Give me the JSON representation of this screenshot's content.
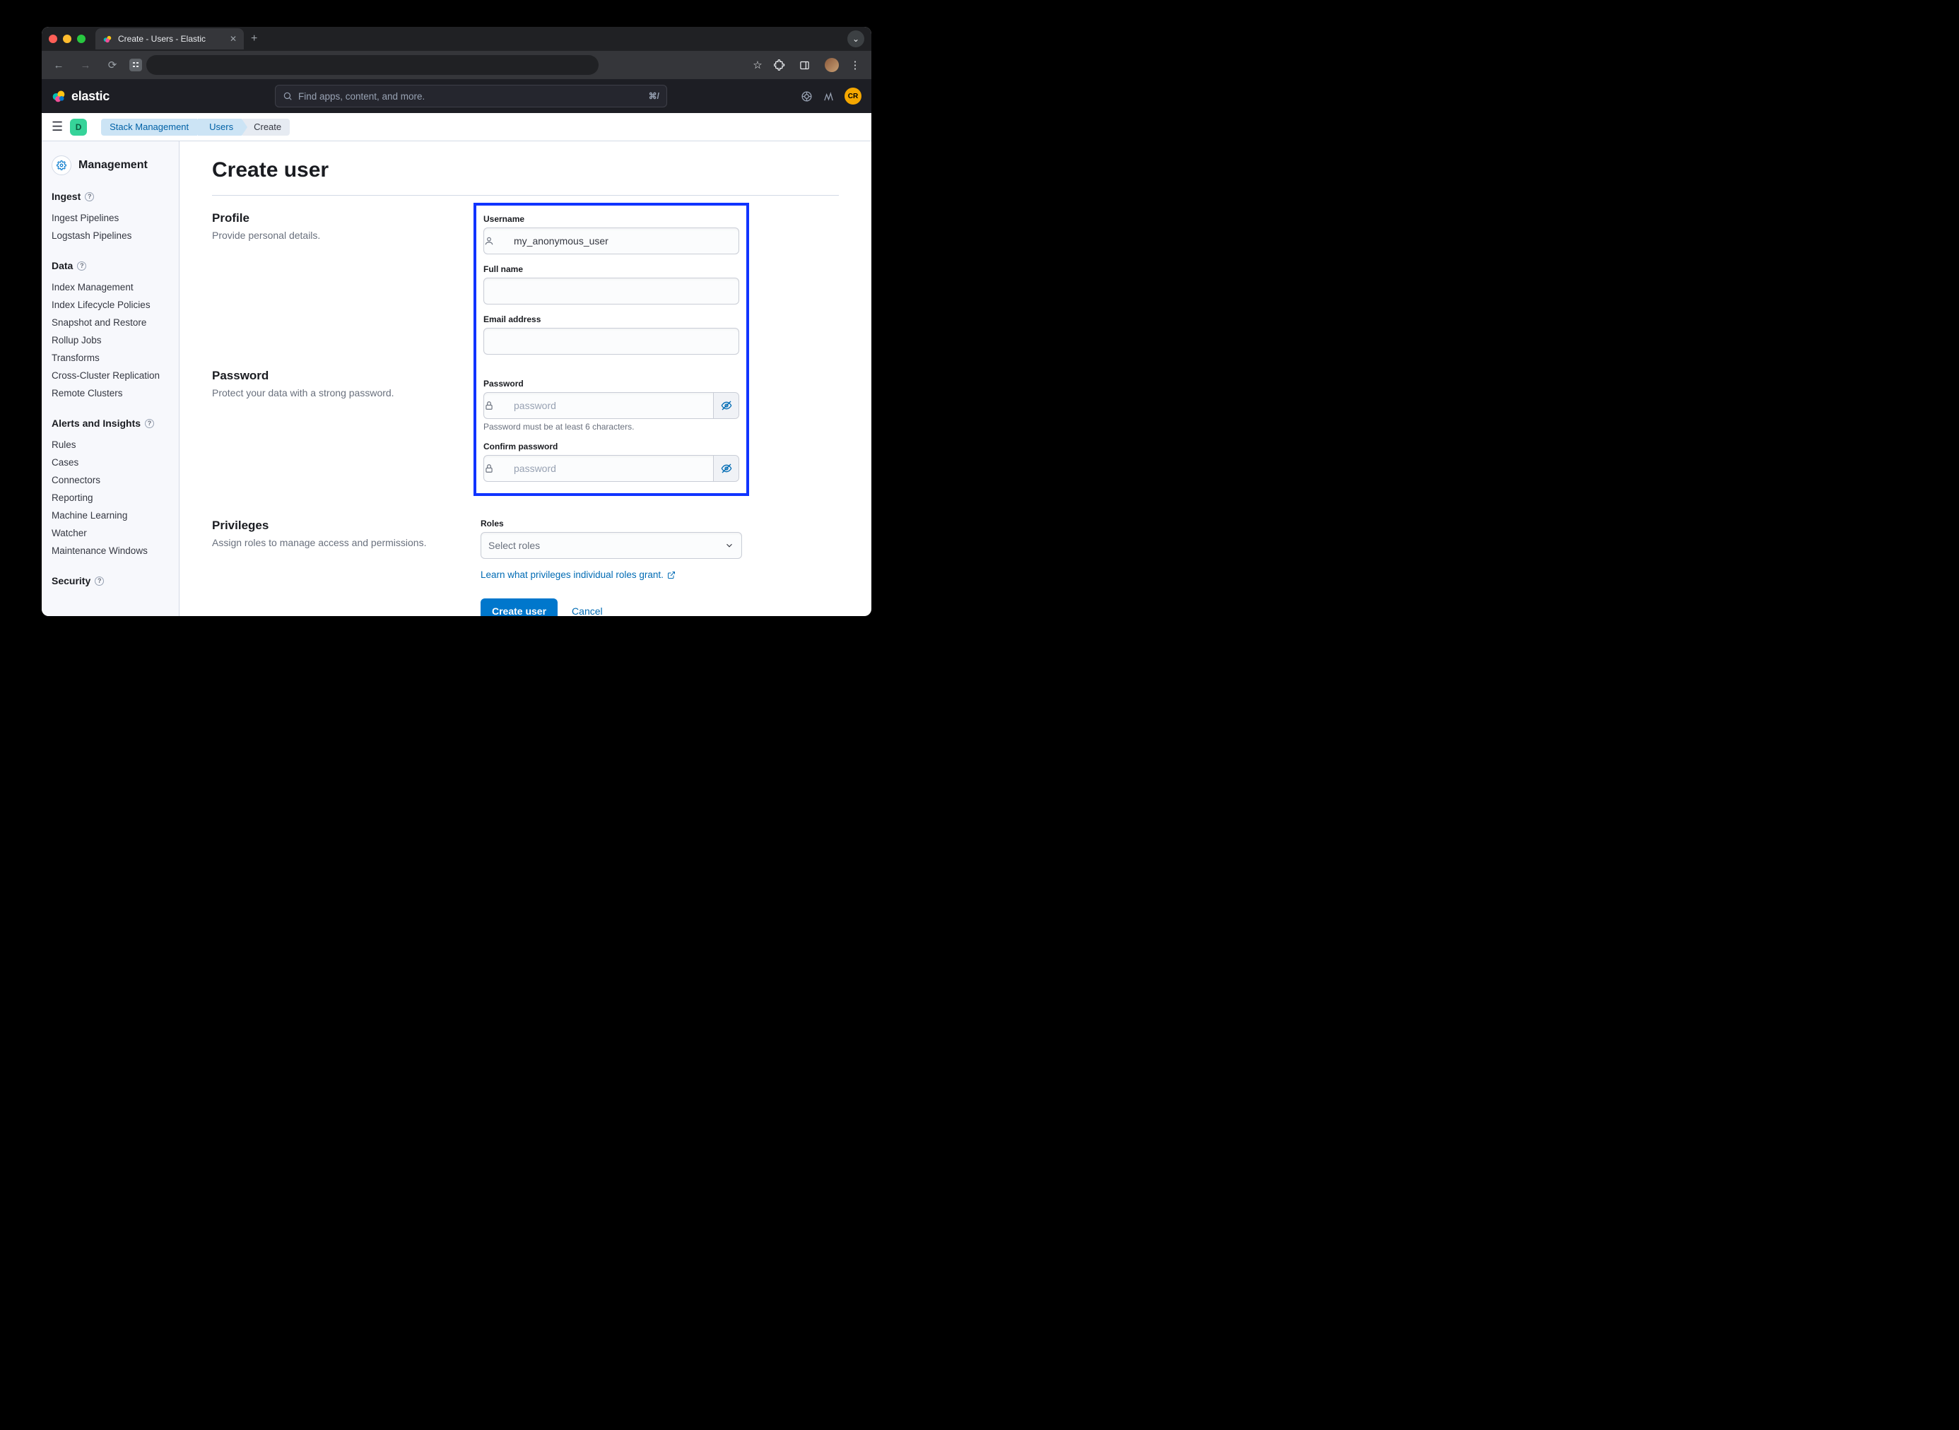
{
  "browser": {
    "tab_title": "Create - Users - Elastic"
  },
  "header": {
    "brand": "elastic",
    "search_placeholder": "Find apps, content, and more.",
    "search_shortcut": "⌘/",
    "avatar_initials": "CR"
  },
  "breadcrumb": {
    "space_initial": "D",
    "items": [
      "Stack Management",
      "Users",
      "Create"
    ]
  },
  "sidebar": {
    "title": "Management",
    "groups": [
      {
        "title": "Ingest",
        "help": true,
        "items": [
          "Ingest Pipelines",
          "Logstash Pipelines"
        ]
      },
      {
        "title": "Data",
        "help": true,
        "items": [
          "Index Management",
          "Index Lifecycle Policies",
          "Snapshot and Restore",
          "Rollup Jobs",
          "Transforms",
          "Cross-Cluster Replication",
          "Remote Clusters"
        ]
      },
      {
        "title": "Alerts and Insights",
        "help": true,
        "items": [
          "Rules",
          "Cases",
          "Connectors",
          "Reporting",
          "Machine Learning",
          "Watcher",
          "Maintenance Windows"
        ]
      },
      {
        "title": "Security",
        "help": true,
        "items": []
      }
    ]
  },
  "page": {
    "title": "Create user",
    "sections": {
      "profile": {
        "heading": "Profile",
        "desc": "Provide personal details.",
        "username_label": "Username",
        "username_value": "my_anonymous_user",
        "fullname_label": "Full name",
        "fullname_value": "",
        "email_label": "Email address",
        "email_value": ""
      },
      "password": {
        "heading": "Password",
        "desc": "Protect your data with a strong password.",
        "password_label": "Password",
        "password_placeholder": "password",
        "password_hint": "Password must be at least 6 characters.",
        "confirm_label": "Confirm password",
        "confirm_placeholder": "password"
      },
      "privileges": {
        "heading": "Privileges",
        "desc": "Assign roles to manage access and permissions.",
        "roles_label": "Roles",
        "roles_placeholder": "Select roles",
        "learn_link": "Learn what privileges individual roles grant."
      }
    },
    "actions": {
      "create": "Create user",
      "cancel": "Cancel"
    }
  }
}
